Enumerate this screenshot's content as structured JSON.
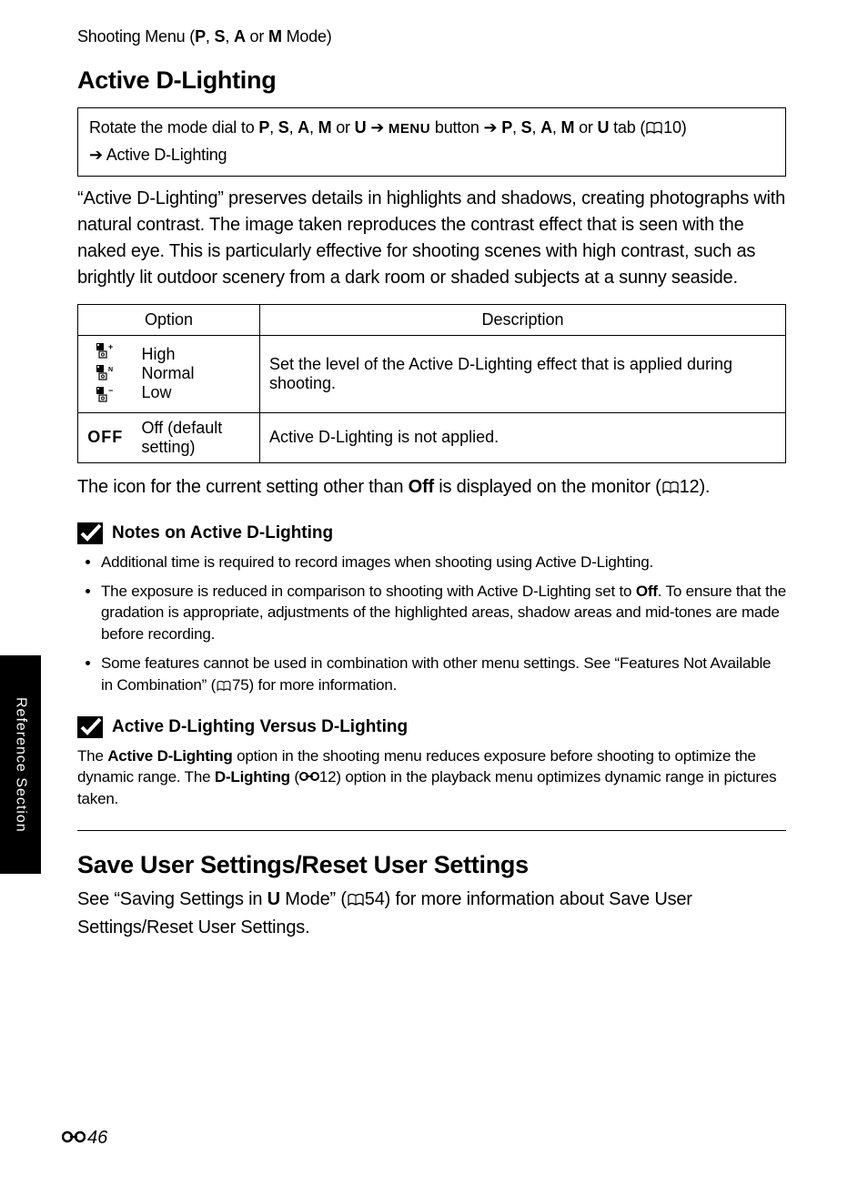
{
  "sidebar_label": "Reference Section",
  "breadcrumb": {
    "pre": "Shooting Menu (",
    "modes": [
      "P",
      "S",
      "A",
      "M"
    ],
    "sep": ", ",
    "post": " Mode)"
  },
  "section1": {
    "title": "Active D-Lighting",
    "nav": {
      "pre": "Rotate the mode dial to ",
      "modes1": [
        "P",
        "S",
        "A",
        "M",
        "U"
      ],
      "arrow": " ➔ ",
      "menu_label": "MENU",
      "btn_text": " button ",
      "modes2": [
        "P",
        "S",
        "A",
        "M",
        "U"
      ],
      "tab_text": " tab (",
      "ref10": "10)",
      "tail": " ➔ Active D-Lighting"
    },
    "body": "“Active D-Lighting” preserves details in highlights and shadows, creating photographs with natural contrast. The image taken reproduces the contrast effect that is seen with the naked eye. This is particularly effective for shooting scenes with high contrast, such as brightly lit outdoor scenery from a dark room or shaded subjects at a sunny seaside.",
    "table": {
      "headers": [
        "Option",
        "Description"
      ],
      "rows": [
        {
          "icon": "adl-levels",
          "labels": [
            "High",
            "Normal",
            "Low"
          ],
          "desc": "Set the level of the Active D-Lighting effect that is applied during shooting."
        },
        {
          "icon": "OFF",
          "labels": [
            "Off (default setting)"
          ],
          "desc": "Active D-Lighting is not applied."
        }
      ]
    },
    "after_pre": "The icon for the current setting other than ",
    "after_bold": "Off",
    "after_mid": " is displayed on the monitor (",
    "after_ref": "12).",
    "note1": {
      "title": "Notes on Active D-Lighting",
      "bullets": [
        {
          "plain": "Additional time is required to record images when shooting using Active D-Lighting."
        },
        {
          "pre": "The exposure is reduced in comparison to shooting with Active D-Lighting set to ",
          "bold": "Off",
          "post": ". To ensure that the gradation is appropriate, adjustments of the highlighted areas, shadow areas and mid-tones are made before recording."
        },
        {
          "pre": "Some features cannot be used in combination with other menu settings. See “Features Not Available in Combination” (",
          "ref": "75) for more information.",
          "post": ""
        }
      ]
    },
    "note2": {
      "title": "Active D-Lighting Versus D-Lighting",
      "para_pre": "The ",
      "para_b1": "Active D-Lighting",
      "para_mid": " option in the shooting menu reduces exposure before shooting to optimize the dynamic range. The ",
      "para_b2": "D-Lighting",
      "para_open": " (",
      "para_ref": "12) option in the playback menu optimizes dynamic range in pictures taken.",
      "para_post": ""
    }
  },
  "section2": {
    "title": "Save User Settings/Reset User Settings",
    "body_pre": "See “Saving Settings in ",
    "body_mode": "U",
    "body_mid": " Mode” (",
    "body_ref": "54) for more information about Save User Settings/Reset User Settings."
  },
  "page_number": "46"
}
